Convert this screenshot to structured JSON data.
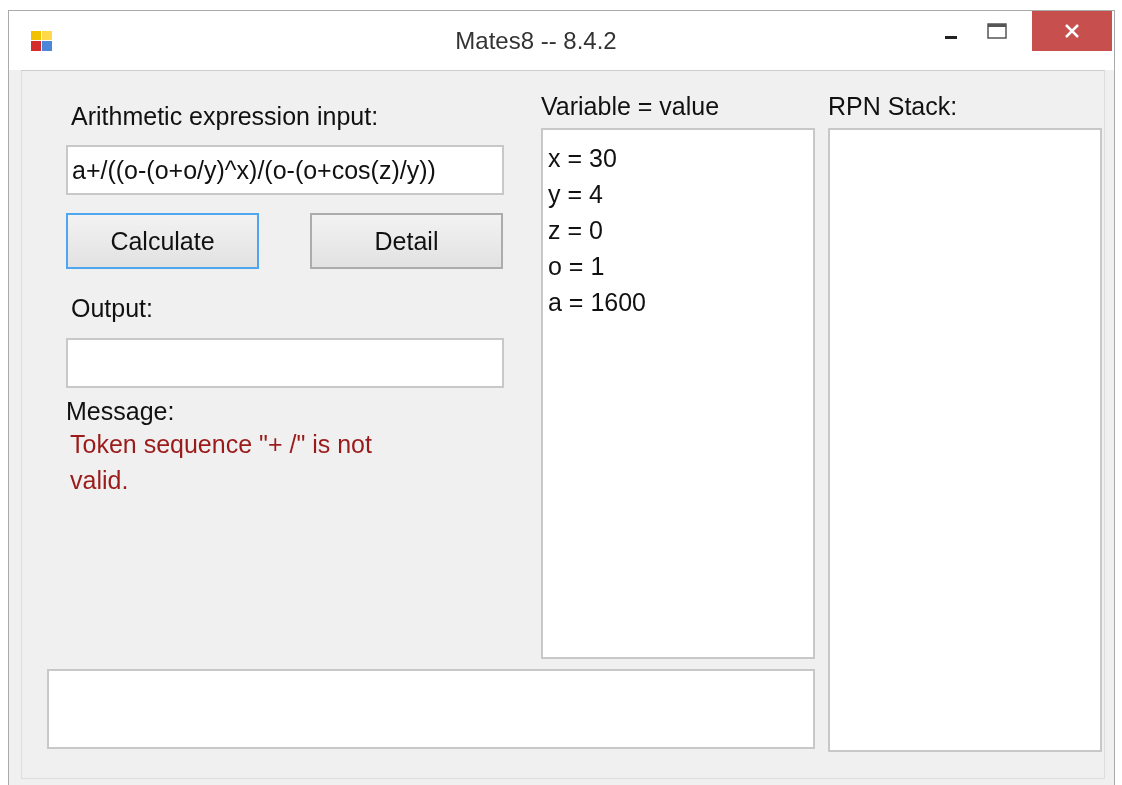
{
  "window": {
    "title": "Mates8 -- 8.4.2"
  },
  "expression": {
    "label": "Arithmetic expression input:",
    "value": "a+/((o-(o+o/y)^x)/(o-(o+cos(z)/y))"
  },
  "buttons": [
    {
      "label": "Calculate",
      "focused": true
    },
    {
      "label": "Detail",
      "focused": false
    }
  ],
  "output": {
    "label": "Output:"
  },
  "message": {
    "label": "Message:",
    "text": "Token sequence \"+ /\" is not valid."
  },
  "variables": {
    "label": "Variable = value",
    "items": [
      "x = 30",
      "y = 4",
      "z = 0",
      "o = 1",
      "a = 1600"
    ]
  },
  "rpn_stack": {
    "label": "RPN Stack:"
  }
}
